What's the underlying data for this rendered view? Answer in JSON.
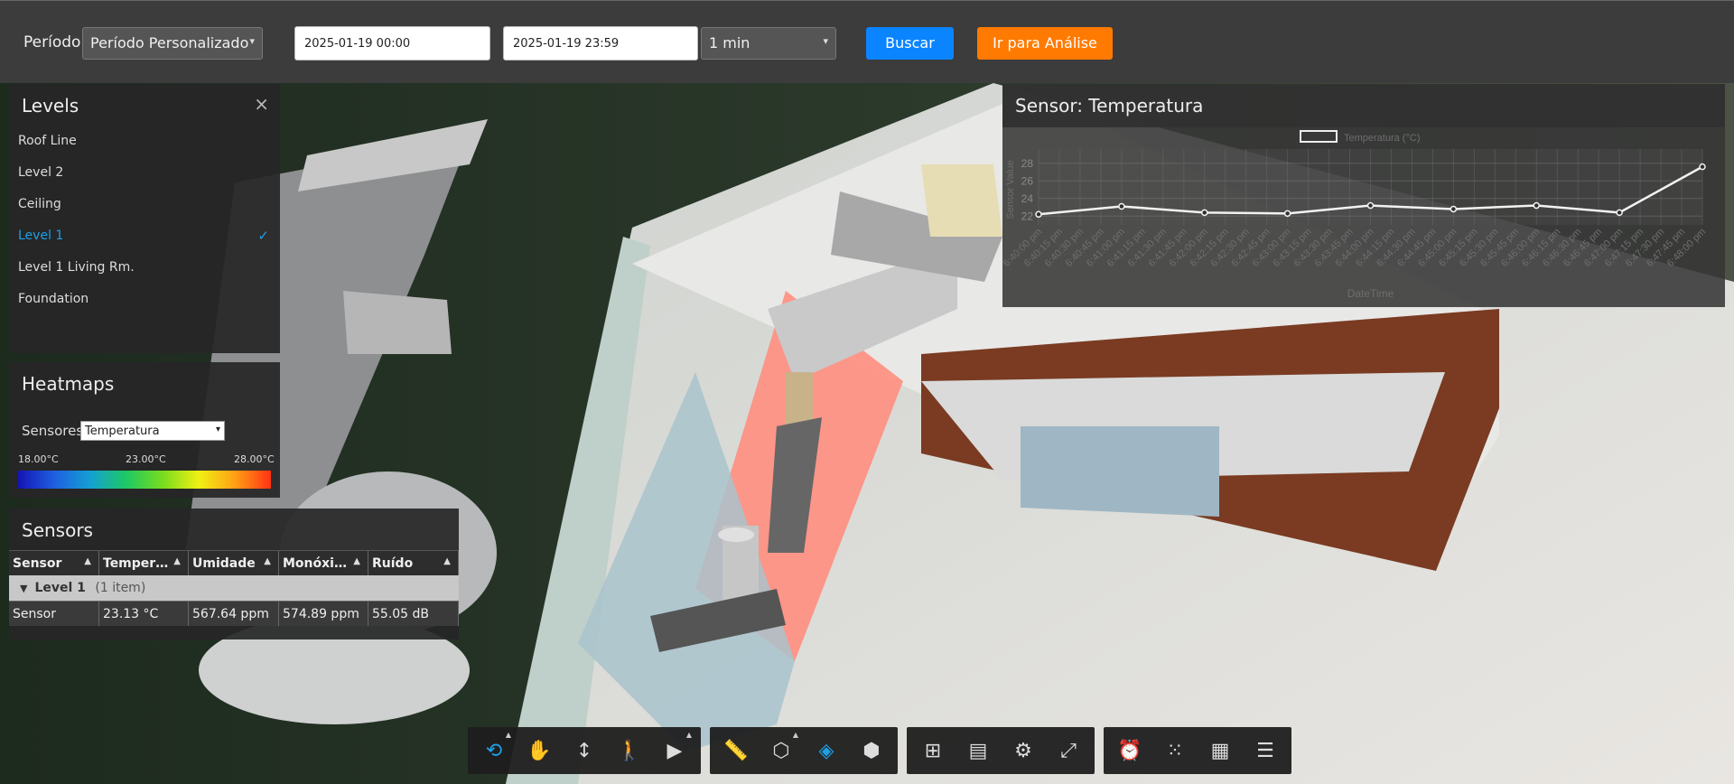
{
  "topbar": {
    "period_label": "Período:",
    "period_value": "Período Personalizado",
    "start": "2025-01-19 00:00",
    "end": "2025-01-19 23:59",
    "interval": "1 min",
    "search_label": "Buscar",
    "analysis_label": "Ir para Análise"
  },
  "levels": {
    "title": "Levels",
    "items": [
      {
        "label": "Roof Line"
      },
      {
        "label": "Level 2"
      },
      {
        "label": "Ceiling"
      },
      {
        "label": "Level 1",
        "selected": true
      },
      {
        "label": "Level 1 Living Rm."
      },
      {
        "label": "Foundation"
      }
    ]
  },
  "heatmaps": {
    "title": "Heatmaps",
    "sensor_label": "Sensores",
    "sensor_value": "Temperatura",
    "scale_min": "18.00°C",
    "scale_mid": "23.00°C",
    "scale_max": "28.00°C"
  },
  "sensors": {
    "title": "Sensors",
    "columns": [
      "Sensor",
      "Temper…",
      "Umidade",
      "Monóxi…",
      "Ruído"
    ],
    "group": "Level 1",
    "group_count": "(1 item)",
    "rows": [
      [
        "Sensor",
        "23.13 °C",
        "567.64 ppm",
        "574.89 ppm",
        "55.05 dB"
      ]
    ]
  },
  "chart_panel": {
    "title": "Sensor: Temperatura"
  },
  "chart_data": {
    "type": "line",
    "title": "",
    "legend": "Temperatura (°C)",
    "legend_position": "top",
    "xlabel": "DateTime",
    "ylabel": "Sensor Value",
    "ylim": [
      21,
      29
    ],
    "yticks": [
      22,
      24,
      26,
      28
    ],
    "grid": true,
    "x": [
      "6:40:00 pm",
      "6:40:15 pm",
      "6:40:30 pm",
      "6:40:45 pm",
      "6:41:00 pm",
      "6:41:15 pm",
      "6:41:30 pm",
      "6:41:45 pm",
      "6:42:00 pm",
      "6:42:15 pm",
      "6:42:30 pm",
      "6:42:45 pm",
      "6:43:00 pm",
      "6:43:15 pm",
      "6:43:30 pm",
      "6:43:45 pm",
      "6:44:00 pm",
      "6:44:15 pm",
      "6:44:30 pm",
      "6:44:45 pm",
      "6:45:00 pm",
      "6:45:15 pm",
      "6:45:30 pm",
      "6:45:45 pm",
      "6:46:00 pm",
      "6:46:15 pm",
      "6:46:30 pm",
      "6:46:45 pm",
      "6:47:00 pm",
      "6:47:15 pm",
      "6:47:30 pm",
      "6:47:45 pm",
      "6:48:00 pm"
    ],
    "series": [
      {
        "name": "Temperatura (°C)",
        "points": [
          {
            "x": "6:40:00 pm",
            "y": 22.2
          },
          {
            "x": "6:41:00 pm",
            "y": 23.1
          },
          {
            "x": "6:42:00 pm",
            "y": 22.4
          },
          {
            "x": "6:43:00 pm",
            "y": 22.3
          },
          {
            "x": "6:44:00 pm",
            "y": 23.2
          },
          {
            "x": "6:45:00 pm",
            "y": 22.8
          },
          {
            "x": "6:46:00 pm",
            "y": 23.2
          },
          {
            "x": "6:47:00 pm",
            "y": 22.4
          },
          {
            "x": "6:48:00 pm",
            "y": 27.6
          }
        ]
      }
    ]
  },
  "toolbar": {
    "groups": [
      [
        "orbit-icon",
        "pan-icon",
        "zoom-icon",
        "walk-icon",
        "camera-icon"
      ],
      [
        "measure-icon",
        "section-icon",
        "layers-icon",
        "explode-icon"
      ],
      [
        "model-browser-icon",
        "properties-icon",
        "settings-icon",
        "fullscreen-icon"
      ],
      [
        "sensor-icon",
        "heatmap-icon",
        "dashboard-icon",
        "list-icon"
      ]
    ]
  }
}
